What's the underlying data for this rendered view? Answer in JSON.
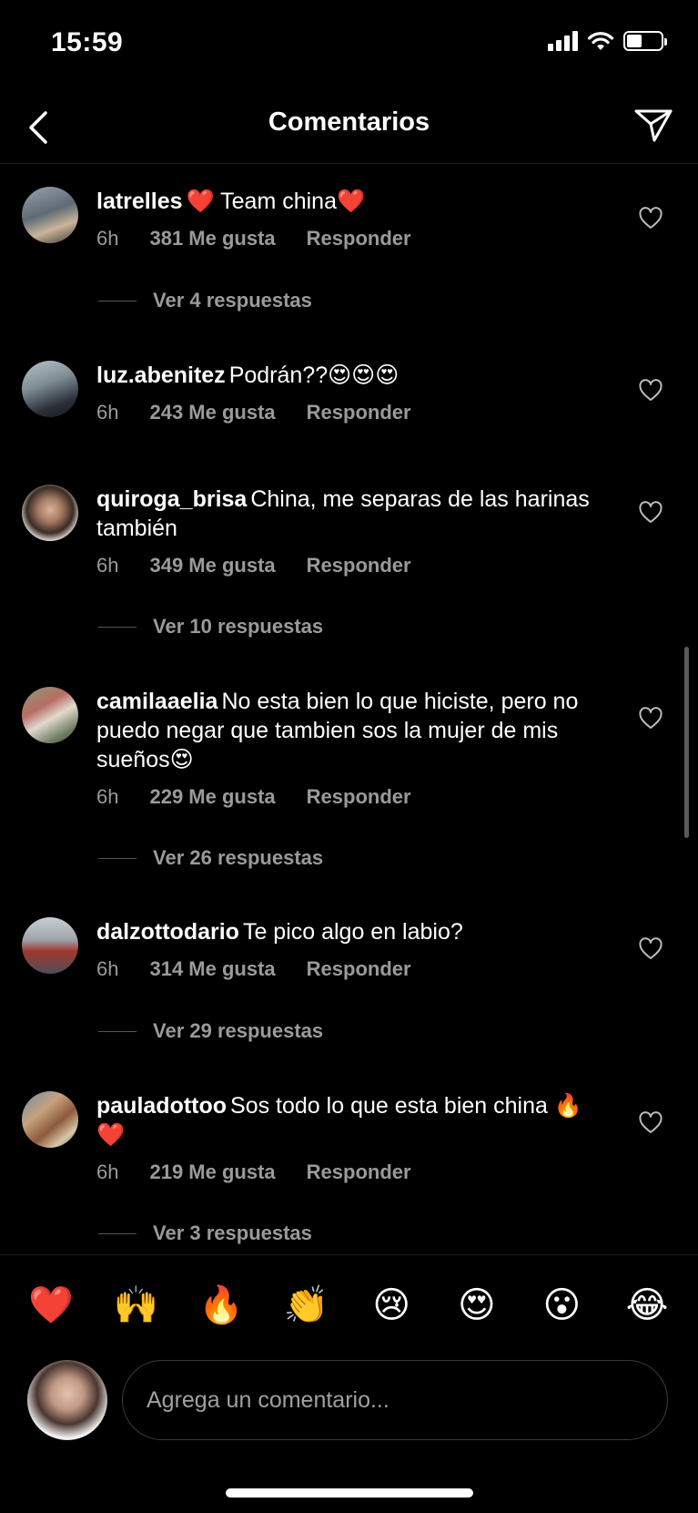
{
  "status_bar": {
    "time": "15:59",
    "battery_level": 0.45
  },
  "header": {
    "title": "Comentarios",
    "back_icon": "chevron-left-icon",
    "share_icon": "paper-plane-icon"
  },
  "comments": [
    {
      "username": "latrelles",
      "text": "❤️ Team china❤️",
      "time": "6h",
      "likes": "381 Me gusta",
      "reply_label": "Responder",
      "replies": "Ver 4 respuestas"
    },
    {
      "username": "luz.abenitez",
      "text": "Podrán??😍😍😍",
      "time": "6h",
      "likes": "243 Me gusta",
      "reply_label": "Responder",
      "replies": ""
    },
    {
      "username": "quiroga_brisa",
      "text": "China, me separas de las harinas también",
      "time": "6h",
      "likes": "349 Me gusta",
      "reply_label": "Responder",
      "replies": "Ver 10 respuestas"
    },
    {
      "username": "camilaaelia",
      "text": "No esta bien lo que hiciste, pero no puedo negar que tambien sos la mujer de mis sueños😍",
      "time": "6h",
      "likes": "229 Me gusta",
      "reply_label": "Responder",
      "replies": "Ver 26 respuestas"
    },
    {
      "username": "dalzottodario",
      "text": "Te pico algo en labio?",
      "time": "6h",
      "likes": "314 Me gusta",
      "reply_label": "Responder",
      "replies": "Ver 29 respuestas"
    },
    {
      "username": "pauladottoo",
      "text": "Sos todo lo que esta bien china 🔥❤️",
      "time": "6h",
      "likes": "219 Me gusta",
      "reply_label": "Responder",
      "replies": "Ver 3 respuestas"
    }
  ],
  "emoji_bar": [
    "❤️",
    "🙌",
    "🔥",
    "👏",
    "😢",
    "😍",
    "😮",
    "😂"
  ],
  "input": {
    "placeholder": "Agrega un comentario..."
  },
  "colors": {
    "background": "#000000",
    "secondary_text": "#9a9a9a",
    "divider": "#1c1c1c"
  }
}
